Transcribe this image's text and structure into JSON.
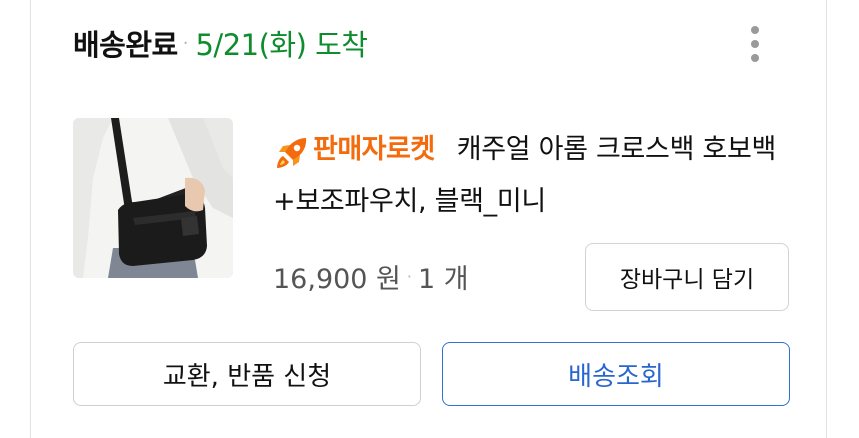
{
  "order": {
    "status": "배송완료",
    "separator": "·",
    "arrival": "5/21(화) 도착"
  },
  "menu": {
    "icon": "more-vertical-icon"
  },
  "product": {
    "thumbnail_icon": "product-photo",
    "badge_icon": "rocket-icon",
    "badge_label": "판매자로켓",
    "name": "캐주얼 아롬 크로스백 호보백 +보조파우치, 블랙_미니",
    "price": "16,900 원",
    "separator": "·",
    "quantity": "1 개"
  },
  "actions": {
    "add_to_cart": "장바구니 담기",
    "exchange_return": "교환, 반품 신청",
    "track_delivery": "배송조회"
  },
  "colors": {
    "arrival_green": "#0f8c2e",
    "rocket_orange": "#f36b0d",
    "track_blue": "#2a66cf"
  }
}
